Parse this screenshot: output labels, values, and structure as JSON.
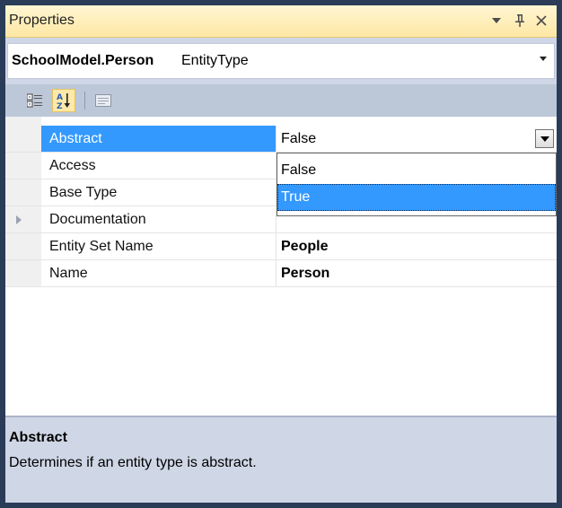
{
  "window": {
    "title": "Properties",
    "buttons": {
      "dropdown_icon": "▾",
      "pin_icon": "ᵽ",
      "close_icon": "✕"
    }
  },
  "selector": {
    "object_name": "SchoolModel.Person",
    "object_type": "EntityType"
  },
  "toolbar": {
    "items": [
      {
        "name": "categorized-icon",
        "active": false
      },
      {
        "name": "alphabetical-icon",
        "active": true
      },
      {
        "name": "property-pages-icon",
        "active": false
      }
    ]
  },
  "properties": [
    {
      "name": "Abstract",
      "value": "False",
      "selected": true,
      "bold": false
    },
    {
      "name": "Access",
      "value": "",
      "selected": false,
      "bold": false
    },
    {
      "name": "Base Type",
      "value": "",
      "selected": false,
      "bold": false
    },
    {
      "name": "Documentation",
      "value": "",
      "selected": false,
      "bold": false,
      "expandable": true
    },
    {
      "name": "Entity Set Name",
      "value": "People",
      "selected": false,
      "bold": true
    },
    {
      "name": "Name",
      "value": "Person",
      "selected": false,
      "bold": true
    }
  ],
  "dropdown": {
    "options": [
      "False",
      "True"
    ],
    "highlighted": "True"
  },
  "description": {
    "title": "Abstract",
    "text": "Determines if an entity type is abstract."
  },
  "colors": {
    "selection": "#3399ff",
    "frame": "#2b3c59",
    "panel": "#cfd6e5"
  }
}
